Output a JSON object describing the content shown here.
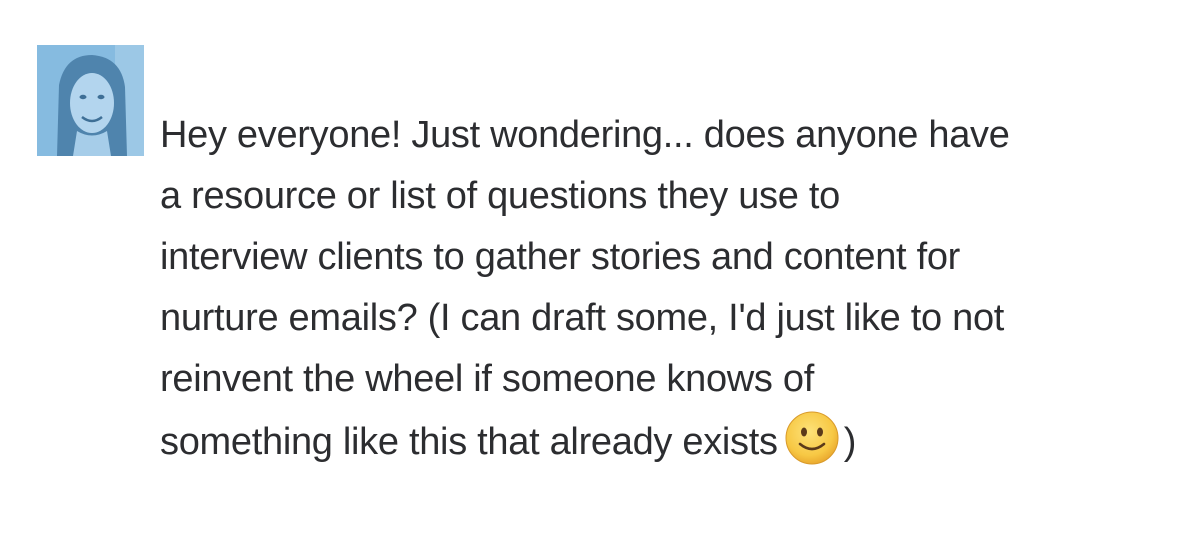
{
  "message": {
    "lines": [
      "Hey everyone! Just wondering... does anyone have",
      "a resource or list of questions they use to",
      "interview clients to gather stories and content for",
      "nurture emails? (I can draft some, I'd just like to not",
      "reinvent the wheel if someone knows of",
      "something like this that already exists"
    ],
    "trailing_text": ")",
    "emoji": "slightly-smiling-face-icon"
  },
  "colors": {
    "text": "#2c2d30",
    "avatar_tint": "#7fb6dd"
  }
}
